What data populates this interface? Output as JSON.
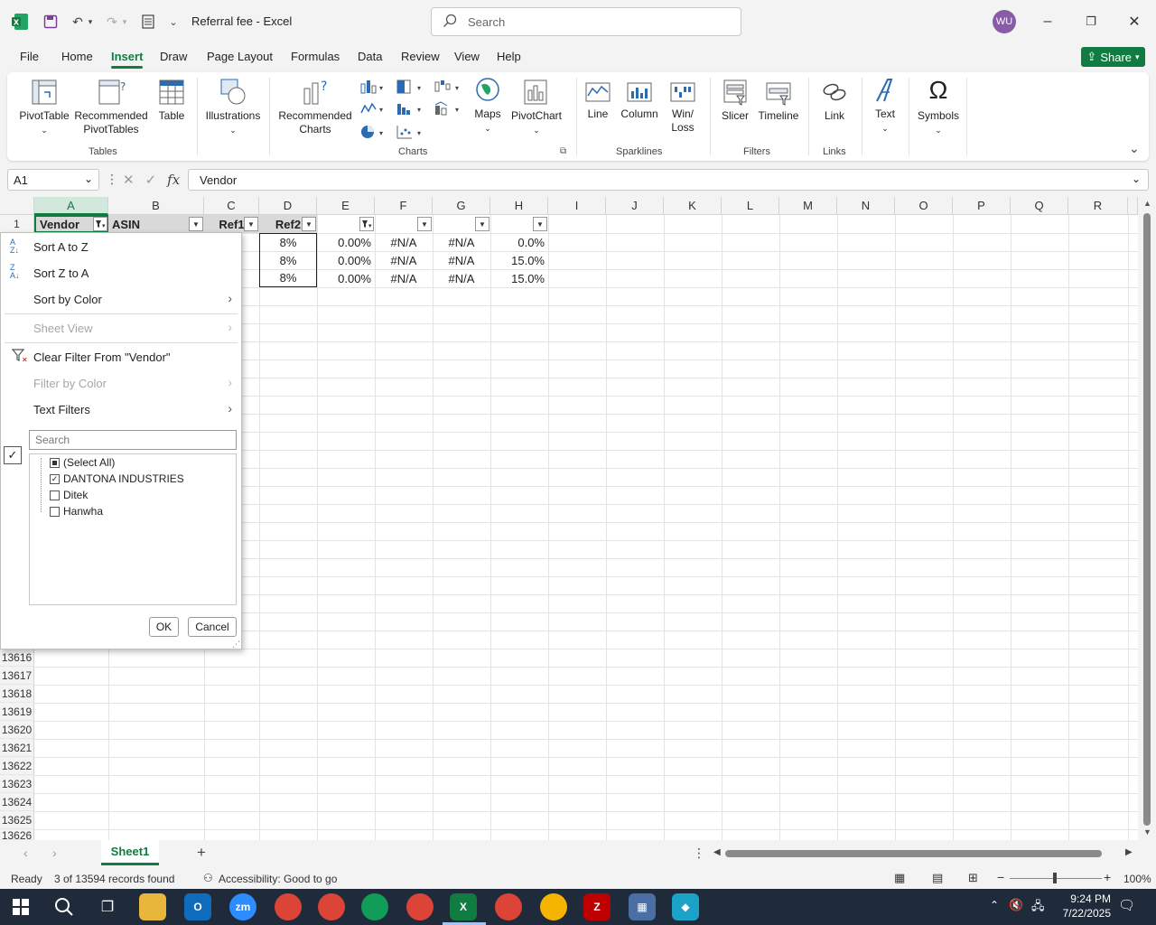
{
  "titlebar": {
    "title": "Referral fee  -  Excel",
    "search_placeholder": "Search",
    "avatar_initials": "WU"
  },
  "menu": {
    "tabs": [
      "File",
      "Home",
      "Insert",
      "Draw",
      "Page Layout",
      "Formulas",
      "Data",
      "Review",
      "View",
      "Help"
    ],
    "active": "Insert",
    "share_label": "Share"
  },
  "ribbon": {
    "tables": {
      "pivottable": "PivotTable",
      "recommended_pivot_1": "Recommended",
      "recommended_pivot_2": "PivotTables",
      "table": "Table",
      "group": "Tables"
    },
    "illustrations": "Illustrations",
    "charts": {
      "recommended_1": "Recommended",
      "recommended_2": "Charts",
      "maps": "Maps",
      "pivotchart": "PivotChart",
      "group": "Charts"
    },
    "sparklines": {
      "line": "Line",
      "column": "Column",
      "winloss_1": "Win/",
      "winloss_2": "Loss",
      "group": "Sparklines"
    },
    "filters": {
      "slicer": "Slicer",
      "timeline": "Timeline",
      "group": "Filters"
    },
    "links": {
      "link": "Link",
      "group": "Links"
    },
    "text": "Text",
    "symbols": "Symbols"
  },
  "formula_bar": {
    "name_box": "A1",
    "fx": "fx",
    "content": "Vendor"
  },
  "grid": {
    "columns": [
      "A",
      "B",
      "C",
      "D",
      "E",
      "F",
      "G",
      "H",
      "I",
      "J",
      "K",
      "L",
      "M",
      "N",
      "O",
      "P",
      "Q",
      "R"
    ],
    "header_row": {
      "row_num": "1",
      "A": "Vendor",
      "B": "ASIN",
      "C": "Ref1",
      "D": "Ref2"
    },
    "data_rows": [
      {
        "D": "8%",
        "E": "0.00%",
        "F": "#N/A",
        "G": "#N/A",
        "H": "0.0%"
      },
      {
        "D": "8%",
        "E": "0.00%",
        "F": "#N/A",
        "G": "#N/A",
        "H": "15.0%"
      },
      {
        "D": "8%",
        "E": "0.00%",
        "F": "#N/A",
        "G": "#N/A",
        "H": "15.0%"
      }
    ],
    "lower_rows": [
      "13616",
      "13617",
      "13618",
      "13619",
      "13620",
      "13621",
      "13622",
      "13623",
      "13624",
      "13625",
      "13626"
    ]
  },
  "filter_menu": {
    "sort_az": "Sort A to Z",
    "sort_za": "Sort Z to A",
    "sort_color": "Sort by Color",
    "sheet_view": "Sheet View",
    "clear_filter": "Clear Filter From \"Vendor\"",
    "filter_color": "Filter by Color",
    "text_filters": "Text Filters",
    "search_placeholder": "Search",
    "items": [
      {
        "label": "(Select All)",
        "state": "partial"
      },
      {
        "label": "DANTONA INDUSTRIES",
        "state": "checked"
      },
      {
        "label": "Ditek",
        "state": "unchecked"
      },
      {
        "label": "Hanwha",
        "state": "unchecked"
      }
    ],
    "ok": "OK",
    "cancel": "Cancel"
  },
  "sheets": {
    "active": "Sheet1"
  },
  "status": {
    "ready": "Ready",
    "records": "3 of 13594 records found",
    "accessibility": "Accessibility: Good to go",
    "zoom": "100%"
  },
  "taskbar": {
    "time": "9:24 PM",
    "date": "7/22/2025"
  },
  "colors": {
    "excel_green": "#107c41",
    "avatar": "#8a5ba8",
    "taskbar": "#1f2a3a"
  }
}
